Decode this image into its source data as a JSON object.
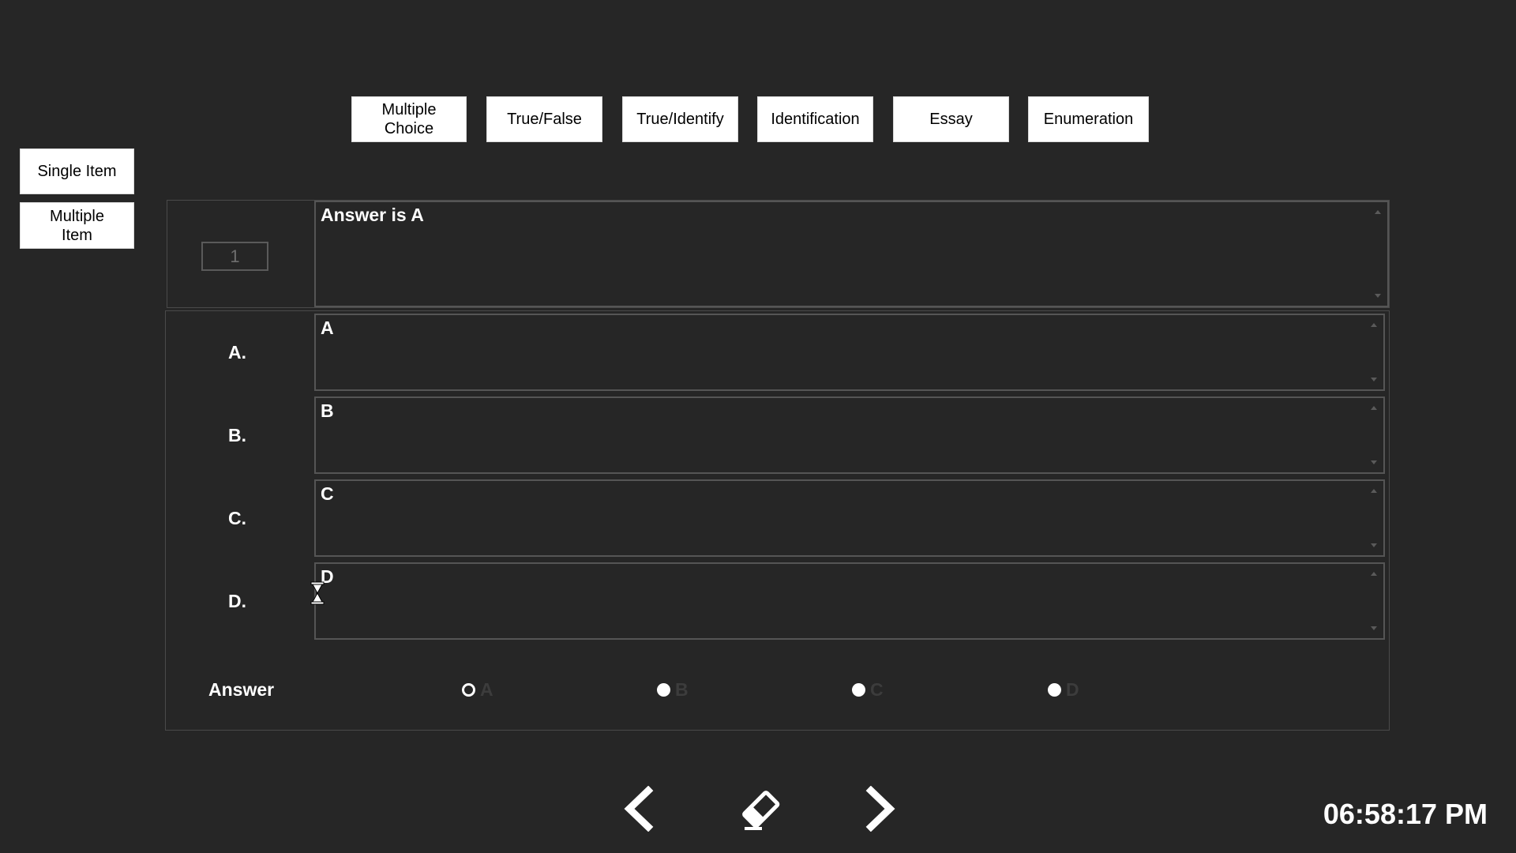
{
  "question_types": [
    {
      "label": "Multiple\nChoice"
    },
    {
      "label": "True/False"
    },
    {
      "label": "True/Identify"
    },
    {
      "label": "Identification"
    },
    {
      "label": "Essay"
    },
    {
      "label": "Enumeration"
    }
  ],
  "item_modes": [
    {
      "label": "Single Item"
    },
    {
      "label": "Multiple\nItem"
    }
  ],
  "question": {
    "number": "1",
    "text": "Answer is A"
  },
  "choices": [
    {
      "letter": "A.",
      "text": "A"
    },
    {
      "letter": "B.",
      "text": "B"
    },
    {
      "letter": "C.",
      "text": "C"
    },
    {
      "letter": "D.",
      "text": "D"
    }
  ],
  "answer": {
    "label": "Answer",
    "options": [
      "A",
      "B",
      "C",
      "D"
    ],
    "selected": "A"
  },
  "nav": {
    "prev_icon": "chevron-left-icon",
    "clear_icon": "eraser-icon",
    "next_icon": "chevron-right-icon"
  },
  "clock": "06:58:17 PM"
}
